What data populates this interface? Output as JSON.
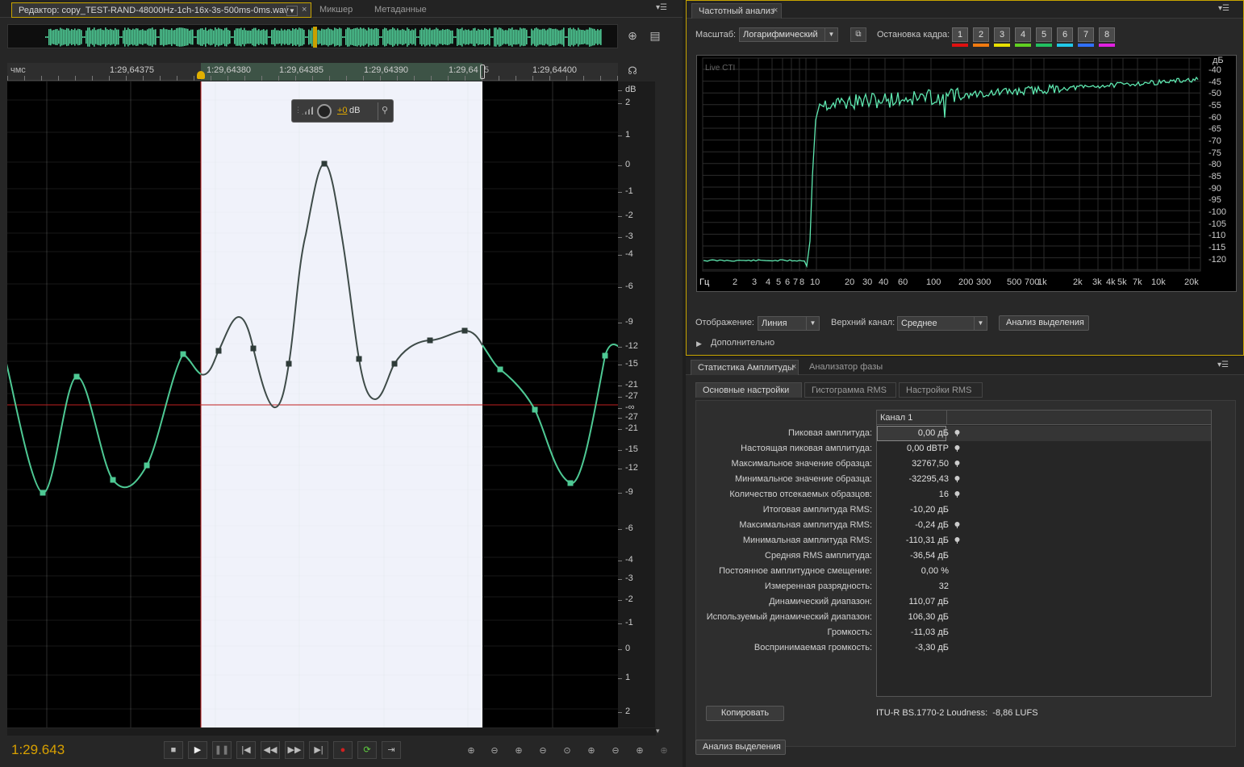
{
  "editor": {
    "tabs": [
      {
        "label": "Редактор: copy_TEST-RAND-48000Hz-1ch-16x-3s-500ms-0ms.wav",
        "active": true
      },
      {
        "label": "Микшер"
      },
      {
        "label": "Метаданные"
      }
    ],
    "ruler": {
      "unit_label": "чмс",
      "ticks": [
        "1:29,64375",
        "1:29,64380",
        "1:29,64385",
        "1:29,64390",
        "1:29,64",
        "5",
        "1:29,64400"
      ]
    },
    "db_scale": [
      "dB",
      "2",
      "1",
      "0",
      "-1",
      "-2",
      "-3",
      "-4",
      "-6",
      "-9",
      "-12",
      "-15",
      "-21",
      "-27",
      "-∞",
      "-27",
      "-21",
      "-15",
      "-12",
      "-9",
      "-6",
      "-4",
      "-3",
      "-2",
      "-1",
      "0",
      "1",
      "2"
    ],
    "hud": {
      "gain": "+0",
      "unit": "dB"
    },
    "time_display": "1:29.643",
    "colors": {
      "waveform": "#4ec994",
      "selection_waveform": "#3e4b48",
      "selection_bg": "#f0f2fa",
      "timecode": "#d8a000",
      "playhead": "#c02020"
    }
  },
  "freq": {
    "tab": "Частотный анализ",
    "scale_label": "Масштаб:",
    "scale_value": "Логарифмический",
    "freeze_label": "Остановка кадра:",
    "freeze_buttons": [
      "1",
      "2",
      "3",
      "4",
      "5",
      "6",
      "7",
      "8"
    ],
    "freeze_colors": [
      "#e01010",
      "#f07a10",
      "#e8e000",
      "#60d020",
      "#20c060",
      "#20c8e8",
      "#3070ff",
      "#e020e0"
    ],
    "plot_label": "Live CTI",
    "x_ticks": [
      "Гц",
      "2",
      "3",
      "4",
      "5",
      "6",
      "7",
      "8",
      "10",
      "20",
      "30",
      "40",
      "60",
      "100",
      "200",
      "300",
      "500",
      "700",
      "1k",
      "2k",
      "3k",
      "4k",
      "5k",
      "7k",
      "10k",
      "20k"
    ],
    "y_ticks": [
      "дБ",
      "-40",
      "-45",
      "-50",
      "-55",
      "-60",
      "-65",
      "-70",
      "-75",
      "-80",
      "-85",
      "-90",
      "-95",
      "-100",
      "-105",
      "-110",
      "-115",
      "-120"
    ],
    "display_label": "Отображение:",
    "display_value": "Линия",
    "channel_label": "Верхний канал:",
    "channel_value": "Среднее",
    "analyze_button": "Анализ выделения",
    "advanced": "Дополнительно",
    "trace_color": "#5ee8b0"
  },
  "stats": {
    "tabs": [
      {
        "label": "Статистика Амплитуды",
        "active": true
      },
      {
        "label": "Анализатор фазы"
      }
    ],
    "subtabs": [
      "Основные настройки",
      "Гистограмма RMS",
      "Настройки RMS"
    ],
    "column": "Канал 1",
    "rows": [
      {
        "label": "Пиковая амплитуда:",
        "value": "0,00 дБ",
        "pin": true
      },
      {
        "label": "Настоящая пиковая амплитуда:",
        "value": "0,00 dBTP",
        "pin": true
      },
      {
        "label": "Максимальное значение образца:",
        "value": "32767,50",
        "pin": true
      },
      {
        "label": "Минимальное значение образца:",
        "value": "-32295,43",
        "pin": true
      },
      {
        "label": "Количество отсекаемых образцов:",
        "value": "16",
        "pin": true
      },
      {
        "label": "Итоговая амплитуда RMS:",
        "value": "-10,20 дБ",
        "pin": false
      },
      {
        "label": "Максимальная амплитуда RMS:",
        "value": "-0,24 дБ",
        "pin": true
      },
      {
        "label": "Минимальная амплитуда RMS:",
        "value": "-110,31 дБ",
        "pin": true
      },
      {
        "label": "Средняя RMS амплитуда:",
        "value": "-36,54 дБ",
        "pin": false
      },
      {
        "label": "Постоянное амплитудное смещение:",
        "value": "0,00 %",
        "pin": false
      },
      {
        "label": "Измеренная разрядность:",
        "value": "32",
        "pin": false
      },
      {
        "label": "Динамический диапазон:",
        "value": "110,07 дБ",
        "pin": false
      },
      {
        "label": "Используемый динамический диапазон:",
        "value": "106,30 дБ",
        "pin": false
      },
      {
        "label": "Громкость:",
        "value": "-11,03 дБ",
        "pin": false
      },
      {
        "label": "Воспринимаемая громкость:",
        "value": "-3,30 дБ",
        "pin": false
      }
    ],
    "copy_button": "Копировать",
    "loudness": "ITU-R BS.1770-2 Loudness:  -8,86 LUFS",
    "analyze_button": "Анализ выделения"
  }
}
